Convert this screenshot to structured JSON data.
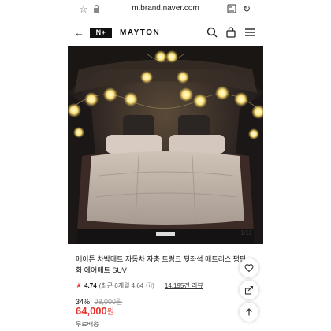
{
  "browser": {
    "url": "m.brand.naver.com"
  },
  "header": {
    "logo_text": "N+",
    "brand_name": "MAYTON"
  },
  "gallery": {
    "counter": "1/11"
  },
  "product": {
    "title": "메이튼 차박매트 자동차 자충 트렁크 뒷좌석 매트리스 평탄화 에어매트 SUV",
    "rating_score": "4.74",
    "rating_note": "(최근 6개월 4.64",
    "review_count": "14,195건 리뷰",
    "discount_rate": "34%",
    "original_price": "98,000원",
    "sale_price": "64,000",
    "price_unit": "원",
    "shipping_text": "무료배송"
  },
  "colors": {
    "price_red": "#e8322c",
    "star_red": "#e8322c"
  },
  "icons": [
    "star-bookmark-icon",
    "lock-icon",
    "reader-icon",
    "reload-icon",
    "back-arrow-icon",
    "search-icon",
    "shopping-bag-icon",
    "menu-icon",
    "heart-icon",
    "share-icon",
    "scroll-top-icon"
  ]
}
